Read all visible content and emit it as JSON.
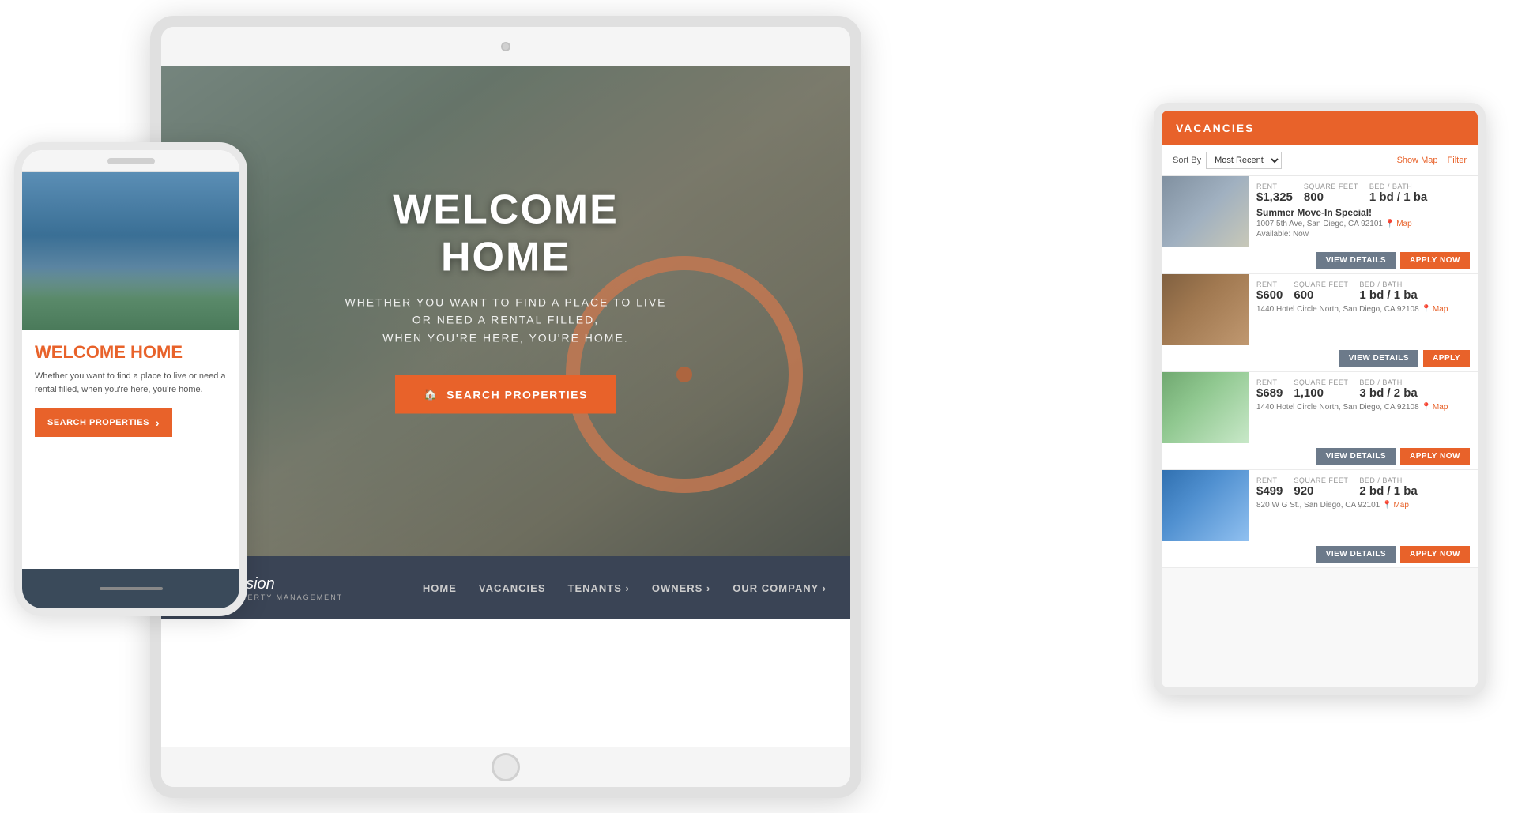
{
  "phone": {
    "welcome_title": "WELCOME HOME",
    "welcome_text": "Whether you want to find a place to live or need a rental filled, when you're here, you're home.",
    "search_btn": "SEARCH PROPERTIES",
    "search_arrow": "›"
  },
  "tablet": {
    "hero": {
      "title": "WELCOME HOME",
      "subtitle_line1": "WHETHER YOU WANT TO FIND A PLACE TO LIVE OR NEED A RENTAL FILLED,",
      "subtitle_line2": "WHEN YOU'RE HERE, YOU'RE HOME.",
      "search_btn": "SEARCH PROPERTIES",
      "search_icon": "🏠"
    },
    "nav": {
      "logo_name": "Mission",
      "logo_subtitle": "PROPERTY MANAGEMENT",
      "links": [
        "HOME",
        "VACANCIES",
        "TENANTS ›",
        "OWNERS ›",
        "OUR COMPANY ›"
      ]
    }
  },
  "vacancies": {
    "header": "VACANCIES",
    "sort_label": "Sort By",
    "sort_value": "Most Recent",
    "show_map": "Show Map",
    "filter": "Filter",
    "items": [
      {
        "id": 1,
        "rent_label": "RENT",
        "sqft_label": "SQUARE FEET",
        "bed_bath_label": "BED / BATH",
        "rent": "$1,325",
        "sqft": "800",
        "bed_bath": "1 bd / 1 ba",
        "title": "Summer Move-In Special!",
        "address": "1007 5th Ave, San Diego, CA 92101",
        "avail": "Available: Now",
        "map_link": "Map",
        "btn_details": "View Details",
        "btn_apply": "Apply Now"
      },
      {
        "id": 2,
        "rent_label": "RENT",
        "sqft_label": "SQUARE FEET",
        "bed_bath_label": "BED / BATH",
        "rent": "$600",
        "sqft": "600",
        "bed_bath": "1 bd / 1 ba",
        "title": "",
        "address": "1440 Hotel Circle North, San Diego, CA 92108",
        "avail": "",
        "map_link": "Map",
        "btn_details": "View Details",
        "btn_apply": "Apply"
      },
      {
        "id": 3,
        "rent_label": "RENT",
        "sqft_label": "SQUARE FEET",
        "bed_bath_label": "BED / BATH",
        "rent": "$689",
        "sqft": "1,100",
        "bed_bath": "3 bd / 2 ba",
        "title": "",
        "address": "1440 Hotel Circle North, San Diego, CA 92108",
        "avail": "",
        "map_link": "Map",
        "btn_details": "View Details",
        "btn_apply": "Apply Now"
      },
      {
        "id": 4,
        "rent_label": "RENT",
        "sqft_label": "SQUARE FEET",
        "bed_bath_label": "BED / BATH",
        "rent": "$499",
        "sqft": "920",
        "bed_bath": "2 bd / 1 ba",
        "title": "",
        "address": "820 W G St., San Diego, CA 92101",
        "avail": "",
        "map_link": "Map",
        "btn_details": "View Details",
        "btn_apply": "Apply Now"
      }
    ]
  }
}
